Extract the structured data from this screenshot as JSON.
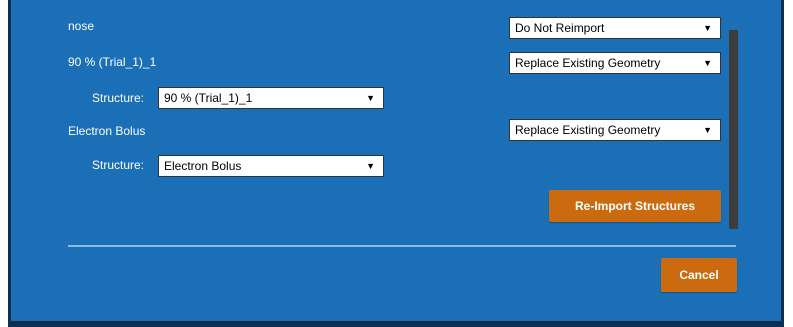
{
  "rows": [
    {
      "name": "nose",
      "action": "Do Not Reimport"
    },
    {
      "name": "90 % (Trial_1)_1",
      "action": "Replace Existing Geometry",
      "structure_label": "Structure:",
      "structure": "90 % (Trial_1)_1"
    },
    {
      "name": "Electron Bolus",
      "action": "Replace Existing Geometry",
      "structure_label": "Structure:",
      "structure": "Electron Bolus"
    }
  ],
  "buttons": {
    "reimport": "Re-Import Structures",
    "cancel": "Cancel"
  },
  "colors": {
    "panel": "#1a6fb7",
    "button": "#cc6a10",
    "frame": "#0d2f52"
  },
  "icons": {
    "dropdown": "chevron-down-icon"
  }
}
